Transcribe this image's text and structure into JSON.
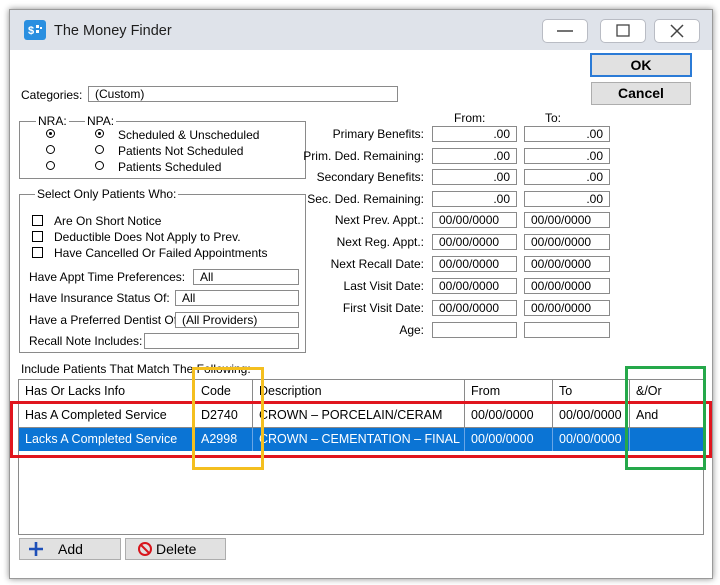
{
  "window": {
    "title": "The Money Finder"
  },
  "dialog_buttons": {
    "ok": "OK",
    "cancel": "Cancel"
  },
  "categories": {
    "label": "Categories:",
    "value": "(Custom)"
  },
  "status_group": {
    "nra_label": "NRA:",
    "npa_label": "NPA:",
    "options": [
      "Scheduled & Unscheduled",
      "Patients Not Scheduled",
      "Patients Scheduled"
    ],
    "nra_selected": 0,
    "npa_selected": 0
  },
  "select_only": {
    "title": "Select Only Patients Who:",
    "checks": [
      {
        "label": "Are On Short Notice",
        "checked": false
      },
      {
        "label": "Deductible Does Not Apply to Prev.",
        "checked": false
      },
      {
        "label": "Have Cancelled Or Failed Appointments",
        "checked": false
      }
    ],
    "appt_time_pref": {
      "label": "Have Appt Time Preferences:",
      "value": "All"
    },
    "insurance_status": {
      "label": "Have Insurance Status Of:",
      "value": "All"
    },
    "preferred_dentist": {
      "label": "Have a Preferred Dentist Of:",
      "value": "(All Providers)"
    },
    "recall_note": {
      "label": "Recall Note Includes:",
      "value": ""
    }
  },
  "ranges": {
    "from_header": "From:",
    "to_header": "To:",
    "rows": [
      {
        "label": "Primary Benefits:",
        "from": ".00",
        "to": ".00"
      },
      {
        "label": "Prim. Ded. Remaining:",
        "from": ".00",
        "to": ".00"
      },
      {
        "label": "Secondary Benefits:",
        "from": ".00",
        "to": ".00"
      },
      {
        "label": "Sec. Ded. Remaining:",
        "from": ".00",
        "to": ".00"
      },
      {
        "label": "Next Prev. Appt.:",
        "from": "00/00/0000",
        "to": "00/00/0000"
      },
      {
        "label": "Next Reg. Appt.:",
        "from": "00/00/0000",
        "to": "00/00/0000"
      },
      {
        "label": "Next Recall Date:",
        "from": "00/00/0000",
        "to": "00/00/0000"
      },
      {
        "label": "Last Visit Date:",
        "from": "00/00/0000",
        "to": "00/00/0000"
      },
      {
        "label": "First Visit Date:",
        "from": "00/00/0000",
        "to": "00/00/0000"
      },
      {
        "label": "Age:",
        "from": "",
        "to": ""
      }
    ]
  },
  "match_table": {
    "caption": "Include Patients That Match The Following:",
    "columns": [
      "Has Or Lacks Info",
      "Code",
      "Description",
      "From",
      "To",
      "&/Or"
    ],
    "rows": [
      [
        "Has A Completed Service",
        "D2740",
        "CROWN – PORCELAIN/CERAM",
        "00/00/0000",
        "00/00/0000",
        "And"
      ],
      [
        "Lacks A Completed Service",
        "A2998",
        "CROWN – CEMENTATION – FINAL",
        "00/00/0000",
        "00/00/0000",
        ""
      ]
    ],
    "selected_row": 1
  },
  "bottom_buttons": {
    "add": "Add",
    "delete": "Delete"
  },
  "colors": {
    "selection": "#0b74d4",
    "highlight_red": "#e0151e",
    "highlight_yellow": "#f4bf1f",
    "highlight_green": "#25a84a",
    "ok_border": "#2b7bd6",
    "titlebar": "#dfe3ea"
  }
}
